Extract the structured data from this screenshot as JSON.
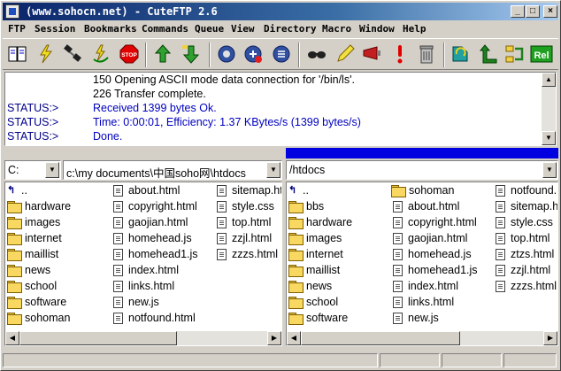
{
  "window": {
    "title": "(www.sohocn.net) - CuteFTP 2.6",
    "minimize_glyph": "_",
    "maximize_glyph": "□",
    "close_glyph": "×"
  },
  "menu": [
    "FTP",
    "Session",
    "Bookmarks",
    "Commands",
    "Queue",
    "View",
    "Directory",
    "Macro",
    "Window",
    "Help"
  ],
  "toolbar_icons": [
    "address-book-icon",
    "connect-icon",
    "disconnect-icon",
    "reconnect-icon",
    "stop-icon",
    "upload-icon",
    "download-icon",
    "refresh-icon",
    "new-folder-icon",
    "queue-icon",
    "glasses-icon",
    "edit-icon",
    "log-icon",
    "alert-icon",
    "delete-icon",
    "transfer-icon",
    "up-dir-icon",
    "sync-icon",
    "rel-icon"
  ],
  "toolbar": {
    "stop_label": "STOP",
    "rel_label": "Rel"
  },
  "log": [
    {
      "prefix": "",
      "message": "150 Opening ASCII mode data connection for '/bin/ls'.",
      "color": "black"
    },
    {
      "prefix": "",
      "message": "226 Transfer complete.",
      "color": "black"
    },
    {
      "prefix": "STATUS:>",
      "message": "Received 1399 bytes Ok.",
      "color": "blue"
    },
    {
      "prefix": "STATUS:>",
      "message": "Time: 0:00:01, Efficiency: 1.37 KBytes/s (1399 bytes/s)",
      "color": "blue"
    },
    {
      "prefix": "STATUS:>",
      "message": "Done.",
      "color": "blue"
    }
  ],
  "local": {
    "drive": "C:",
    "path": "c:\\my documents\\中国soho网\\htdocs",
    "up_label": "..",
    "columns": [
      [
        {
          "type": "up",
          "name": ".."
        },
        {
          "type": "folder",
          "name": "hardware"
        },
        {
          "type": "folder",
          "name": "images"
        },
        {
          "type": "folder",
          "name": "internet"
        },
        {
          "type": "folder",
          "name": "maillist"
        },
        {
          "type": "folder",
          "name": "news"
        },
        {
          "type": "folder",
          "name": "school"
        },
        {
          "type": "folder",
          "name": "software"
        },
        {
          "type": "folder",
          "name": "sohoman"
        }
      ],
      [
        {
          "type": "file",
          "name": "about.html"
        },
        {
          "type": "file",
          "name": "copyright.html"
        },
        {
          "type": "file",
          "name": "gaojian.html"
        },
        {
          "type": "file",
          "name": "homehead.js"
        },
        {
          "type": "file",
          "name": "homehead1.js"
        },
        {
          "type": "file",
          "name": "index.html"
        },
        {
          "type": "file",
          "name": "links.html"
        },
        {
          "type": "file",
          "name": "new.js"
        },
        {
          "type": "file",
          "name": "notfound.html"
        }
      ],
      [
        {
          "type": "file",
          "name": "sitemap.html"
        },
        {
          "type": "file",
          "name": "style.css"
        },
        {
          "type": "file",
          "name": "top.html"
        },
        {
          "type": "file",
          "name": "zzjl.html"
        },
        {
          "type": "file",
          "name": "zzzs.html"
        }
      ]
    ]
  },
  "remote": {
    "path": "/htdocs",
    "columns": [
      [
        {
          "type": "up",
          "name": ".."
        },
        {
          "type": "folder",
          "name": "bbs"
        },
        {
          "type": "folder",
          "name": "hardware"
        },
        {
          "type": "folder",
          "name": "images"
        },
        {
          "type": "folder",
          "name": "internet"
        },
        {
          "type": "folder",
          "name": "maillist"
        },
        {
          "type": "folder",
          "name": "news"
        },
        {
          "type": "folder",
          "name": "school"
        },
        {
          "type": "folder",
          "name": "software"
        }
      ],
      [
        {
          "type": "folder",
          "name": "sohoman"
        },
        {
          "type": "file",
          "name": "about.html"
        },
        {
          "type": "file",
          "name": "copyright.html"
        },
        {
          "type": "file",
          "name": "gaojian.html"
        },
        {
          "type": "file",
          "name": "homehead.js"
        },
        {
          "type": "file",
          "name": "homehead1.js"
        },
        {
          "type": "file",
          "name": "index.html"
        },
        {
          "type": "file",
          "name": "links.html"
        },
        {
          "type": "file",
          "name": "new.js"
        }
      ],
      [
        {
          "type": "file",
          "name": "notfound.html"
        },
        {
          "type": "file",
          "name": "sitemap.html"
        },
        {
          "type": "file",
          "name": "style.css"
        },
        {
          "type": "file",
          "name": "top.html"
        },
        {
          "type": "file",
          "name": "ztzs.html"
        },
        {
          "type": "file",
          "name": "zzjl.html"
        },
        {
          "type": "file",
          "name": "zzzs.html"
        }
      ]
    ]
  },
  "colors": {
    "status_blue": "#0000c0",
    "title_start": "#0a246a",
    "title_end": "#a6caf0",
    "remote_header": "#0000e0"
  }
}
